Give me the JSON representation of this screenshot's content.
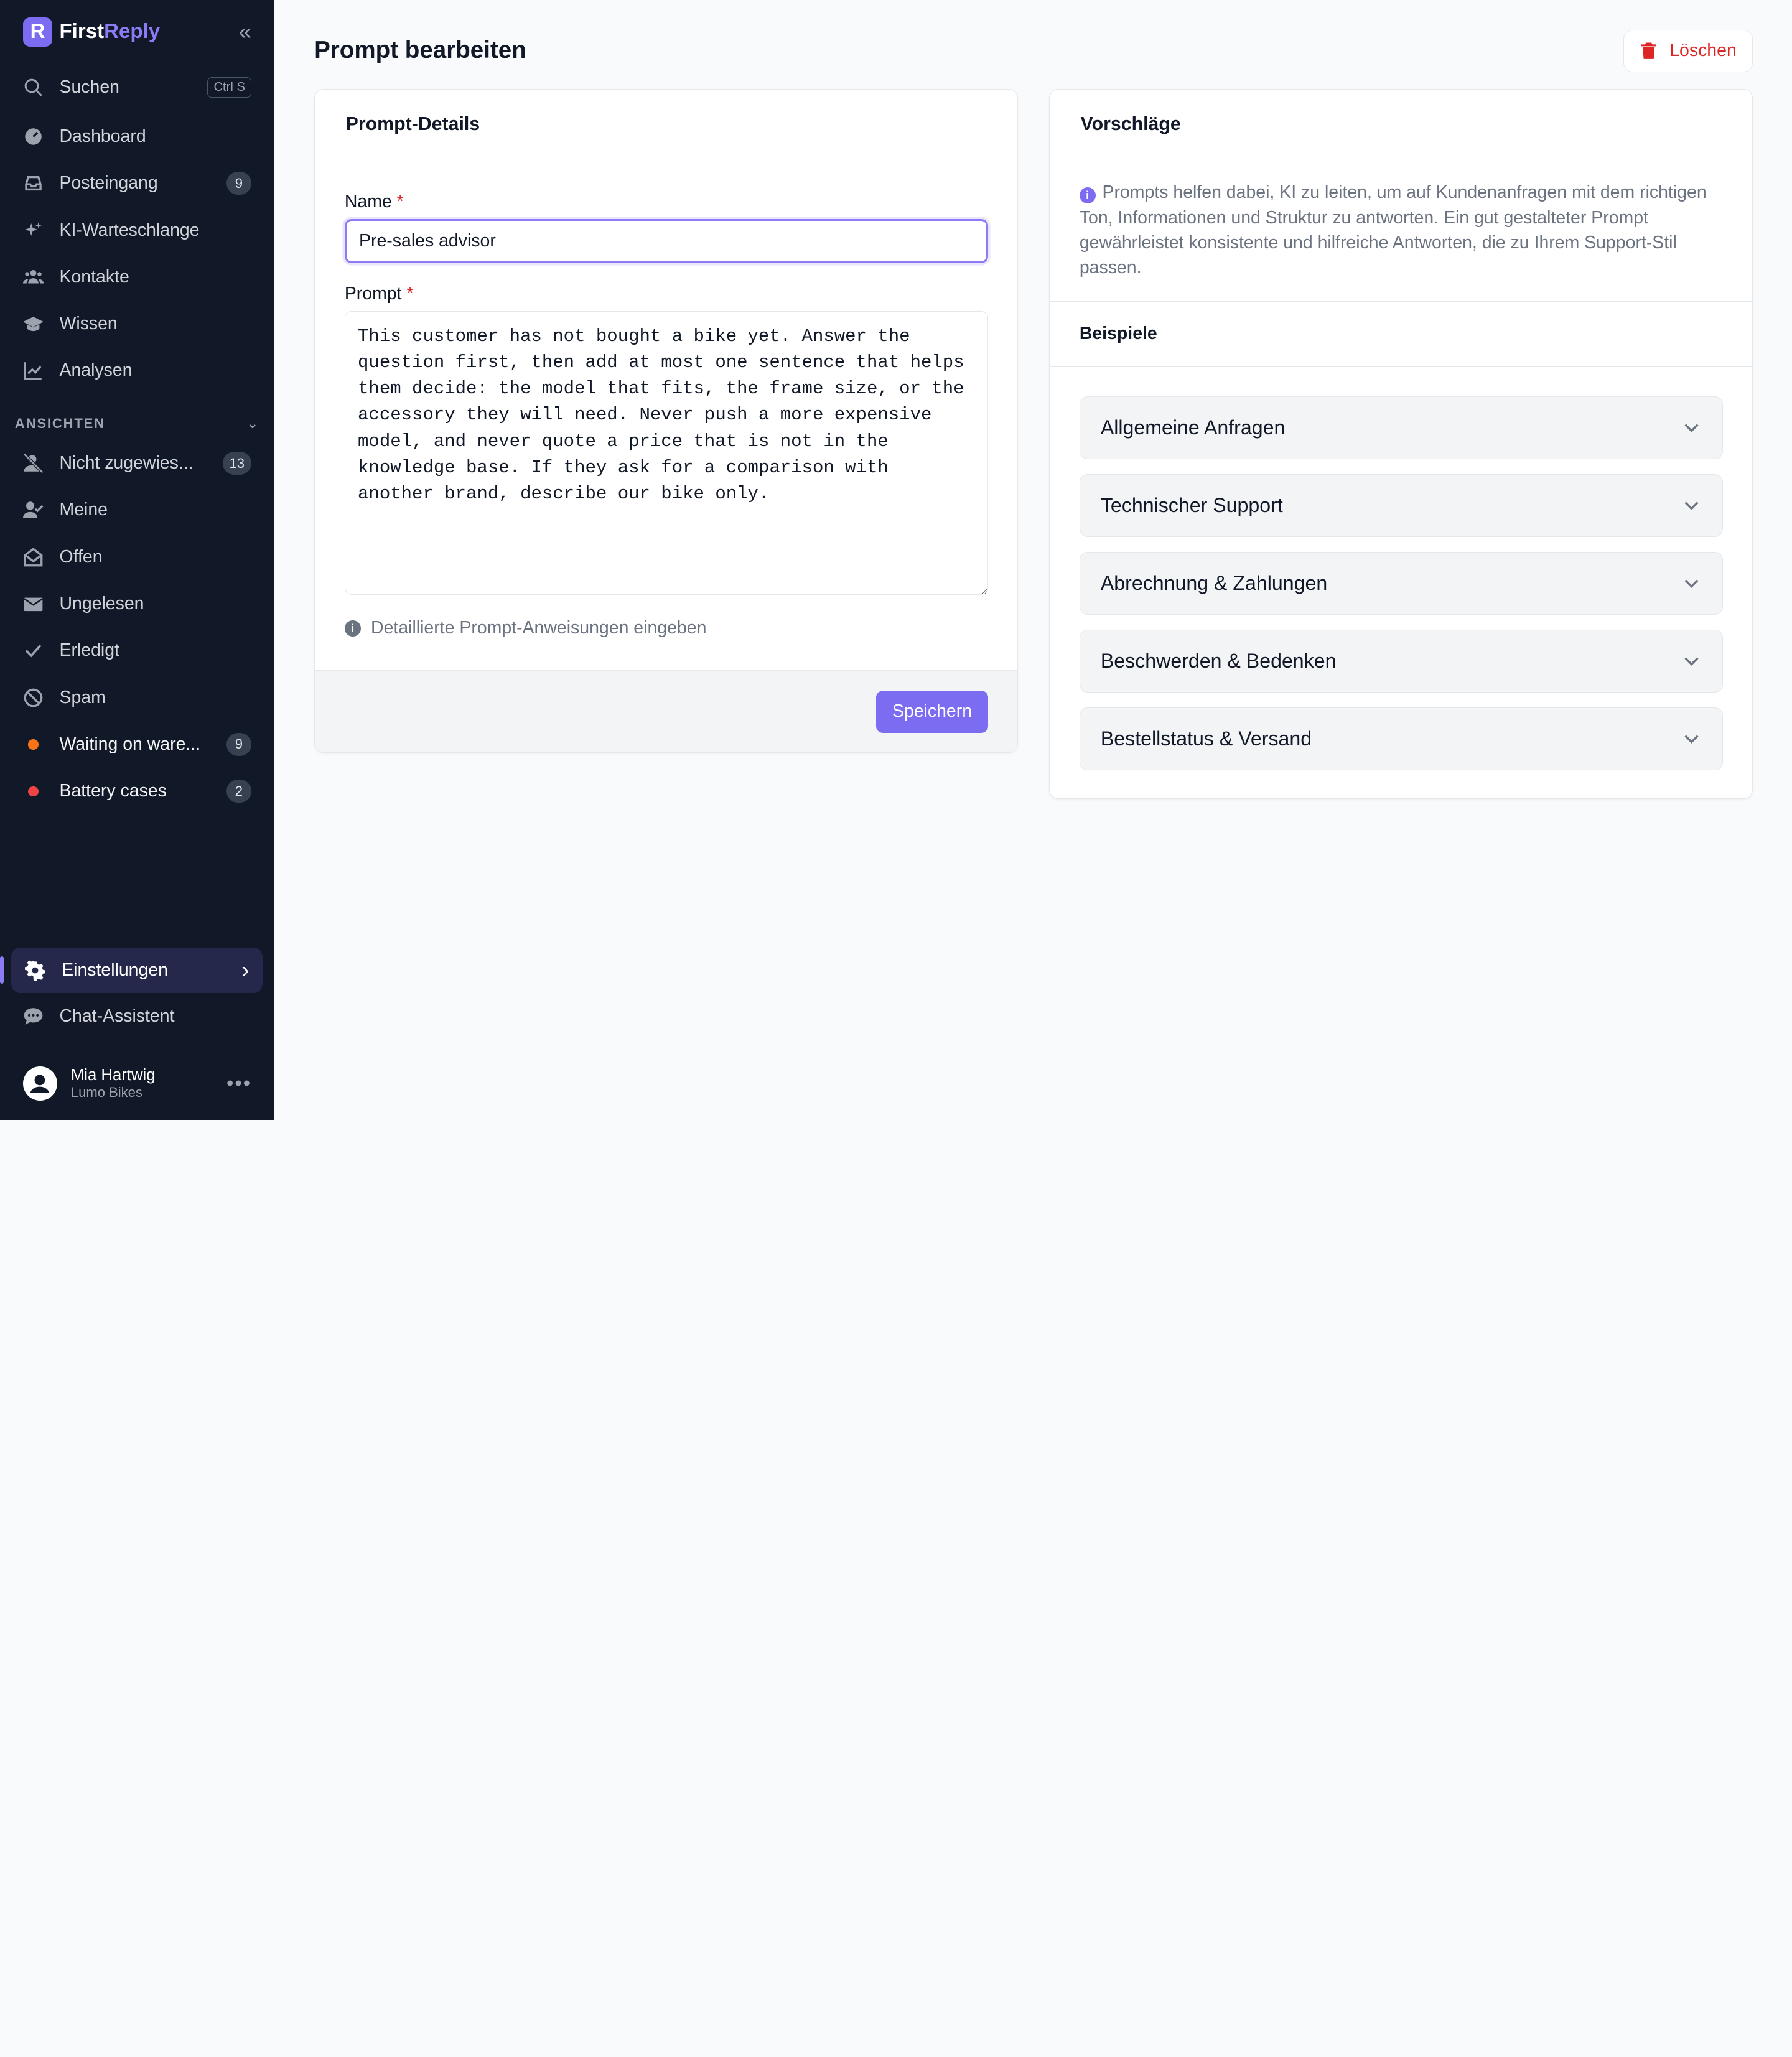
{
  "brand": {
    "logo_letter": "R",
    "name_part1": "First",
    "name_part2": "Reply",
    "accent_color": "#7c6cf2"
  },
  "sidebar": {
    "search": {
      "label": "Suchen",
      "shortcut": "Ctrl S"
    },
    "nav": [
      {
        "label": "Dashboard",
        "icon": "dashboard-icon"
      },
      {
        "label": "Posteingang",
        "icon": "inbox-icon",
        "count": "9"
      },
      {
        "label": "KI-Warteschlange",
        "icon": "sparkles-icon"
      },
      {
        "label": "Kontakte",
        "icon": "users-icon"
      },
      {
        "label": "Wissen",
        "icon": "graduation-cap-icon"
      },
      {
        "label": "Analysen",
        "icon": "chart-line-icon"
      }
    ],
    "views_section": "ANSICHTEN",
    "views": [
      {
        "label": "Nicht zugewies...",
        "icon": "user-slash-icon",
        "count": "13"
      },
      {
        "label": "Meine",
        "icon": "user-check-icon"
      },
      {
        "label": "Offen",
        "icon": "envelope-open-icon"
      },
      {
        "label": "Ungelesen",
        "icon": "envelope-icon"
      },
      {
        "label": "Erledigt",
        "icon": "check-icon"
      },
      {
        "label": "Spam",
        "icon": "ban-icon"
      }
    ],
    "labels": [
      {
        "label": "Waiting on ware...",
        "color": "#f97316",
        "count": "9"
      },
      {
        "label": "Battery cases",
        "color": "#ef4444",
        "count": "2"
      }
    ],
    "settings": "Einstellungen",
    "chat_assistant": "Chat-Assistent",
    "user": {
      "name": "Mia Hartwig",
      "company": "Lumo Bikes"
    }
  },
  "page": {
    "title": "Prompt bearbeiten",
    "delete_label": "Löschen"
  },
  "details": {
    "header": "Prompt-Details",
    "name_label": "Name",
    "name_value": "Pre-sales advisor",
    "prompt_label": "Prompt",
    "prompt_value": "This customer has not bought a bike yet. Answer the question first, then add at most one sentence that helps them decide: the model that fits, the frame size, or the accessory they will need. Never push a more expensive model, and never quote a price that is not in the knowledge base. If they ask for a comparison with another brand, describe our bike only.",
    "hint": "Detaillierte Prompt-Anweisungen eingeben",
    "save_label": "Speichern"
  },
  "suggestions": {
    "header": "Vorschläge",
    "info": "Prompts helfen dabei, KI zu leiten, um auf Kundenanfragen mit dem richtigen Ton, Informationen und Struktur zu antworten. Ein gut gestalteter Prompt gewährleistet konsistente und hilfreiche Antworten, die zu Ihrem Support-Stil passen.",
    "examples_header": "Beispiele",
    "examples": [
      "Allgemeine Anfragen",
      "Technischer Support",
      "Abrechnung & Zahlungen",
      "Beschwerden & Bedenken",
      "Bestellstatus & Versand"
    ]
  }
}
